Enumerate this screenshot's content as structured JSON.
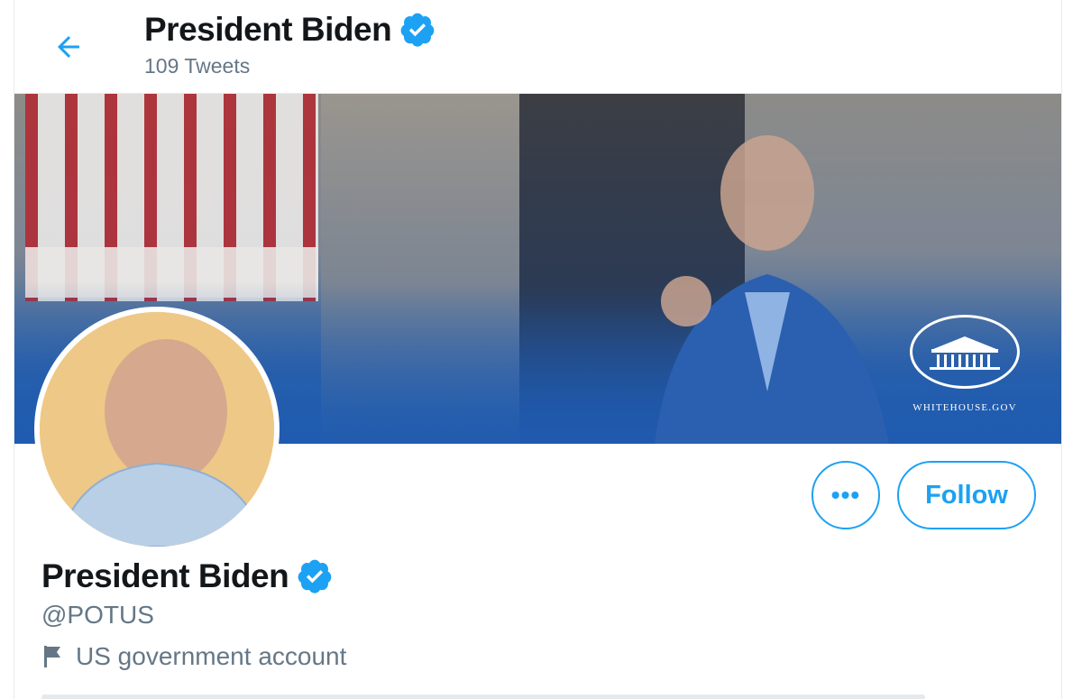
{
  "header": {
    "name": "President Biden",
    "tweet_count": "109 Tweets",
    "verified_icon": "verified-badge-icon",
    "back_icon": "arrow-left-icon"
  },
  "banner": {
    "seal_caption": "WHITEHOUSE.GOV",
    "seal_icon": "white-house-seal-icon"
  },
  "actions": {
    "more_label": "•••",
    "follow_label": "Follow"
  },
  "profile": {
    "name": "President Biden",
    "handle": "@POTUS",
    "label": "US government account",
    "label_icon": "flag-icon"
  },
  "colors": {
    "accent": "#1da1f2",
    "secondary_text": "#657786",
    "primary_text": "#14171a"
  }
}
